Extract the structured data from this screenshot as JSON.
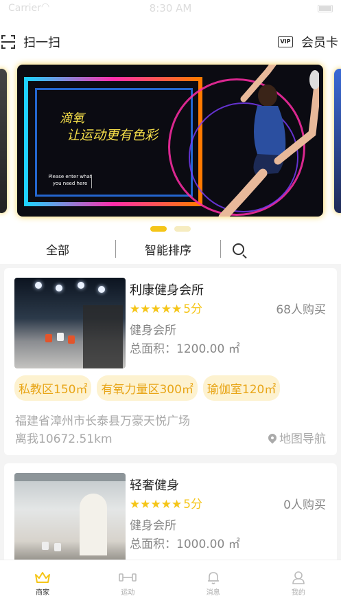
{
  "status_bar": {
    "carrier": "Carrier",
    "time": "8:30 AM"
  },
  "header": {
    "scan_label": "扫一扫",
    "vip_badge": "VIP",
    "member_card_label": "会员卡"
  },
  "banner": {
    "title_line1": "滴氧",
    "title_line2": "让运动更有色彩",
    "hint": "Please enter what you need here",
    "active_index": 0,
    "slide_count": 2
  },
  "filter": {
    "all_label": "全部",
    "sort_label": "智能排序",
    "search_icon": "search-icon"
  },
  "stores": [
    {
      "name": "利康健身会所",
      "stars": "★★★★★",
      "score": "5分",
      "bought": "68人购买",
      "type": "健身会所",
      "area_label": "总面积：",
      "area_value": "1200.00 ㎡",
      "tags": [
        "私教区150㎡",
        "有氧力量区300㎡",
        "瑜伽室120㎡"
      ],
      "address": "福建省漳州市长泰县万豪天悦广场",
      "distance": "离我10672.51km",
      "map_nav": "地图导航"
    },
    {
      "name": "轻奢健身",
      "stars": "★★★★★",
      "score": "5分",
      "bought": "0人购买",
      "type": "健身会所",
      "area_label": "总面积：",
      "area_value": "1000.00 ㎡"
    }
  ],
  "tabbar": {
    "items": [
      {
        "label": "商家",
        "icon": "crown-icon"
      },
      {
        "label": "运动",
        "icon": "dumbbell-icon"
      },
      {
        "label": "消息",
        "icon": "bell-icon"
      },
      {
        "label": "我的",
        "icon": "user-icon"
      }
    ]
  },
  "colors": {
    "accent": "#f5c518",
    "tag_bg": "#fdf2d0",
    "tag_text": "#e8a517"
  }
}
